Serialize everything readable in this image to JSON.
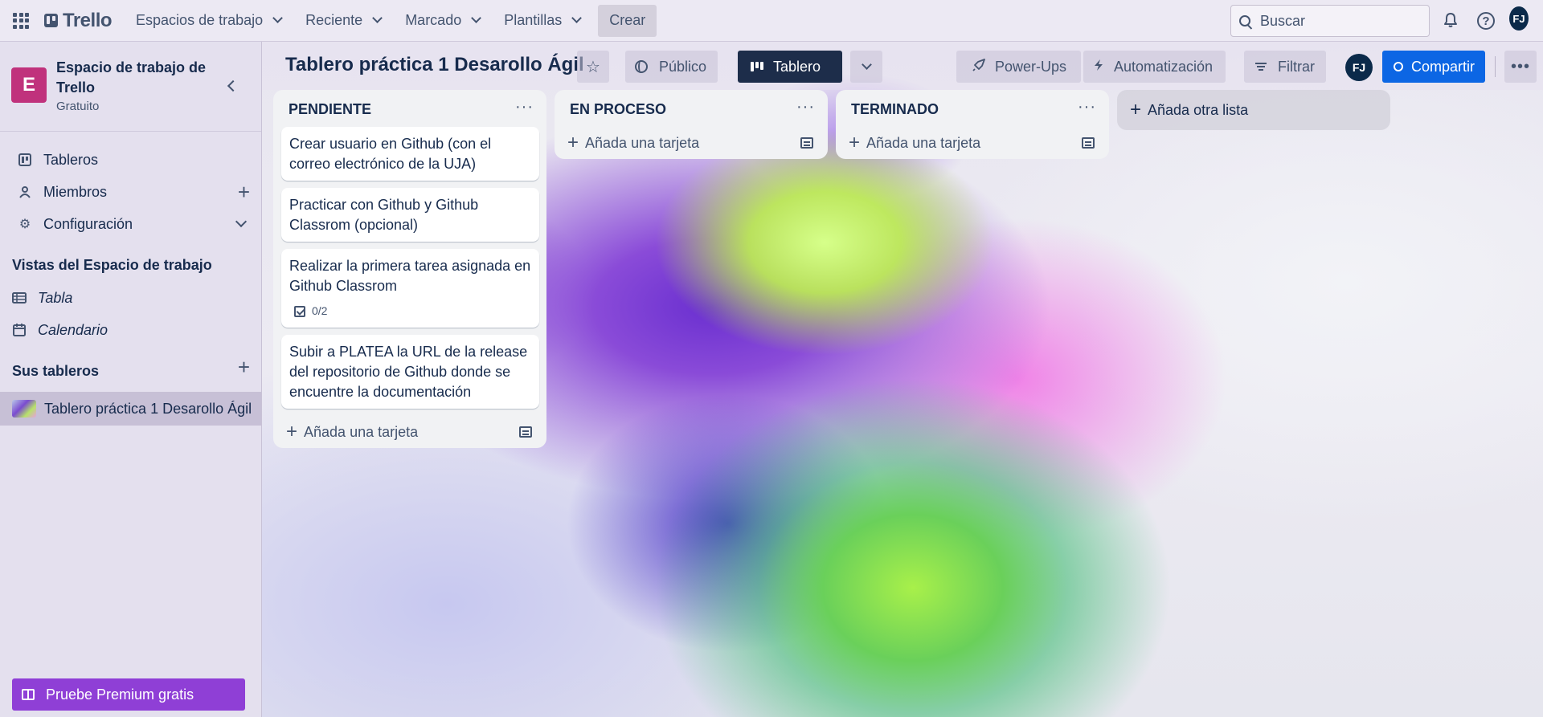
{
  "topnav": {
    "logo": "Trello",
    "menus": [
      "Espacios de trabajo",
      "Reciente",
      "Marcado",
      "Plantillas"
    ],
    "create": "Crear",
    "search_placeholder": "Buscar",
    "avatar": "FJ"
  },
  "sidebar": {
    "workspace_initial": "E",
    "workspace_name": "Espacio de trabajo de Trello",
    "workspace_plan": "Gratuito",
    "items": [
      {
        "label": "Tableros"
      },
      {
        "label": "Miembros"
      },
      {
        "label": "Configuración"
      }
    ],
    "views_heading": "Vistas del Espacio de trabajo",
    "views": [
      {
        "label": "Tabla"
      },
      {
        "label": "Calendario"
      }
    ],
    "boards_heading": "Sus tableros",
    "boards": [
      {
        "label": "Tablero práctica 1 Desarollo Ágil"
      }
    ],
    "premium": "Pruebe Premium gratis"
  },
  "board": {
    "title": "Tablero práctica 1 Desarollo Ágil",
    "visibility": "Público",
    "view": "Tablero",
    "powerups": "Power-Ups",
    "automation": "Automatización",
    "filter": "Filtrar",
    "member_avatar": "FJ",
    "share": "Compartir",
    "add_list": "Añada otra lista"
  },
  "lists": [
    {
      "title": "PENDIENTE",
      "cards": [
        {
          "text": "Crear usuario en Github (con el correo electrónico de la UJA)"
        },
        {
          "text": "Practicar con Github y Github Classrom (opcional)"
        },
        {
          "text": "Realizar la primera tarea asignada en Github Classrom",
          "checklist": "0/2"
        },
        {
          "text": "Subir a PLATEA la URL de la release del repositorio de Github donde se encuentre la documentación"
        }
      ],
      "add_card": "Añada una tarjeta"
    },
    {
      "title": "EN PROCESO",
      "cards": [],
      "add_card": "Añada una tarjeta"
    },
    {
      "title": "TERMINADO",
      "cards": [],
      "add_card": "Añada una tarjeta"
    }
  ]
}
